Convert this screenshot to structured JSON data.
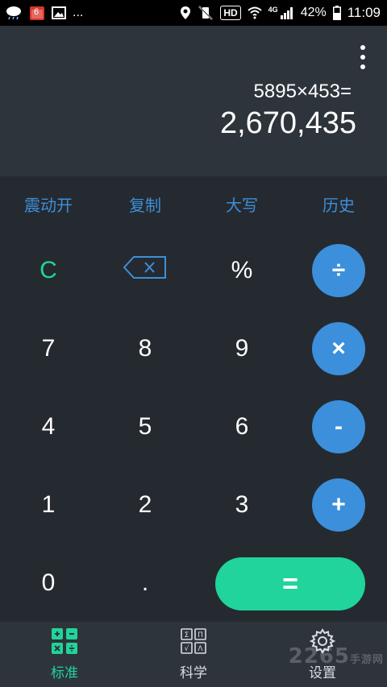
{
  "statusbar": {
    "calendar_day": "6",
    "more": "...",
    "hd": "HD",
    "network": "4G",
    "battery": "42%",
    "time": "11:09"
  },
  "display": {
    "expression": "5895×453=",
    "result": "2,670,435"
  },
  "function_bar": {
    "vibration": "震动开",
    "copy": "复制",
    "uppercase": "大写",
    "history": "历史"
  },
  "keys": {
    "clear": "C",
    "percent": "%",
    "divide": "÷",
    "seven": "7",
    "eight": "8",
    "nine": "9",
    "multiply": "×",
    "four": "4",
    "five": "5",
    "six": "6",
    "minus": "-",
    "one": "1",
    "two": "2",
    "three": "3",
    "plus": "+",
    "zero": "0",
    "dot": ".",
    "equals": "="
  },
  "nav": {
    "standard": "标准",
    "scientific": "科学",
    "settings": "设置"
  },
  "watermark": {
    "main": "2265",
    "sub": "手游网"
  },
  "colors": {
    "accent_green": "#20d49b",
    "accent_blue": "#3b8fdb",
    "text_blue": "#3d8fd6",
    "background": "#252a31"
  }
}
